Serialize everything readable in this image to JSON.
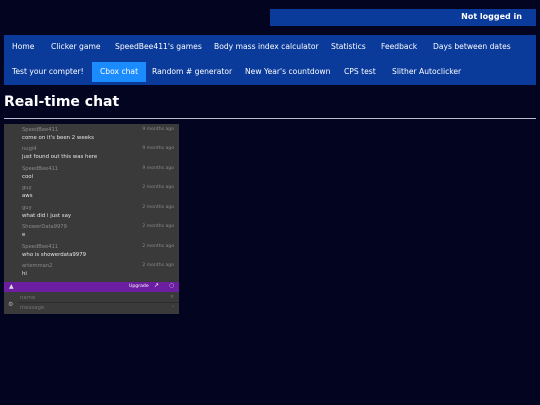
{
  "login_status": "Not logged in",
  "nav": {
    "row1": [
      {
        "label": "Home"
      },
      {
        "label": "Clicker game"
      },
      {
        "label": "SpeedBee411's games"
      },
      {
        "label": "Body mass index calculator"
      },
      {
        "label": "Statistics"
      },
      {
        "label": "Feedback"
      },
      {
        "label": "Days between dates"
      }
    ],
    "row2": [
      {
        "label": "Test your compter!"
      },
      {
        "label": "Cbox chat",
        "active": true
      },
      {
        "label": "Random # generator"
      },
      {
        "label": "New Year's countdown"
      },
      {
        "label": "CPS test"
      },
      {
        "label": "Slither Autoclicker"
      }
    ]
  },
  "page_title": "Real-time chat",
  "chat": {
    "messages": [
      {
        "user": "SpeedBee411",
        "time": "9 months ago",
        "text": "come on it's been 2 weeks"
      },
      {
        "user": "nugi4",
        "time": "9 months ago",
        "text": "just found out this was here"
      },
      {
        "user": "SpeedBee411",
        "time": "9 months ago",
        "text": "cool"
      },
      {
        "user": "guy",
        "time": "2 months ago",
        "text": "aws"
      },
      {
        "user": "guy",
        "time": "2 months ago",
        "text": "what did i just say"
      },
      {
        "user": "ShowerData9979",
        "time": "2 months ago",
        "text": "e"
      },
      {
        "user": "SpeedBee411",
        "time": "2 months ago",
        "text": "who is showerdata9979"
      },
      {
        "user": "artemman2",
        "time": "2 months ago",
        "text": "hi"
      }
    ],
    "upgrade_label": "Upgrade",
    "name_placeholder": "name",
    "message_placeholder": "message",
    "accent_color": "#6b1fa0"
  },
  "colors": {
    "background": "#020420",
    "nav": "#0a3a9a",
    "active_tab": "#1a8cff"
  }
}
